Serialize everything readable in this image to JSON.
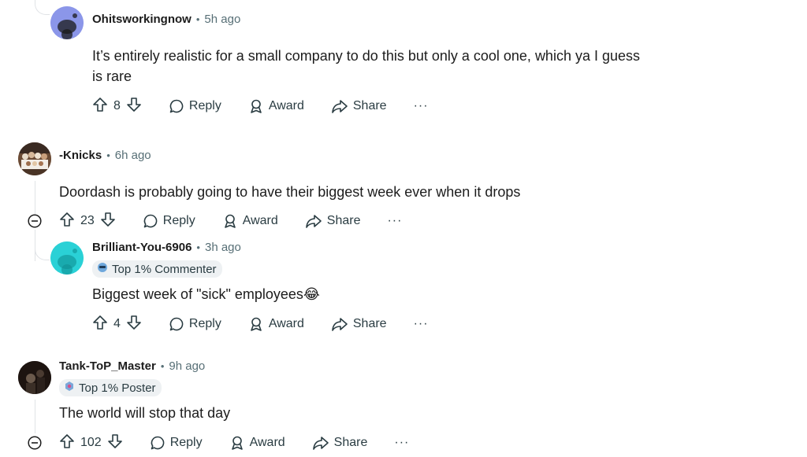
{
  "comments": [
    {
      "author": "Ohitsworkingnow",
      "time": "5h ago",
      "body": [
        "It’s entirely realistic for a small company to do this but only a cool one, which ya I guess",
        "is rare"
      ],
      "votes": "8",
      "avatar_color": "#8b96e9"
    },
    {
      "author": "-Knicks",
      "time": "6h ago",
      "body": [
        "Doordash is probably going to have their biggest week ever when it drops"
      ],
      "votes": "23"
    },
    {
      "author": "Brilliant-You-6906",
      "time": "3h ago",
      "flair": "Top 1% Commenter",
      "body": [
        "Biggest week of \"sick\" employees"
      ],
      "emoji": "😂",
      "votes": "4",
      "avatar_color": "#2ad1d6"
    },
    {
      "author": "Tank-ToP_Master",
      "time": "9h ago",
      "flair": "Top 1% Poster",
      "body": [
        "The world will stop that day"
      ],
      "votes": "102"
    }
  ],
  "actions": {
    "reply": "Reply",
    "award": "Award",
    "share": "Share",
    "more": "···",
    "separator": "•"
  },
  "icons": [
    "upvote-icon",
    "downvote-icon",
    "reply-bubble-icon",
    "award-icon",
    "share-arrow-icon",
    "more-icon",
    "collapse-icon",
    "flair-icon"
  ],
  "colors": {
    "text": "#1c1c1c",
    "meta": "#576f76",
    "flair_bg": "#eef1f3",
    "thread_line": "#e0e3e6"
  }
}
